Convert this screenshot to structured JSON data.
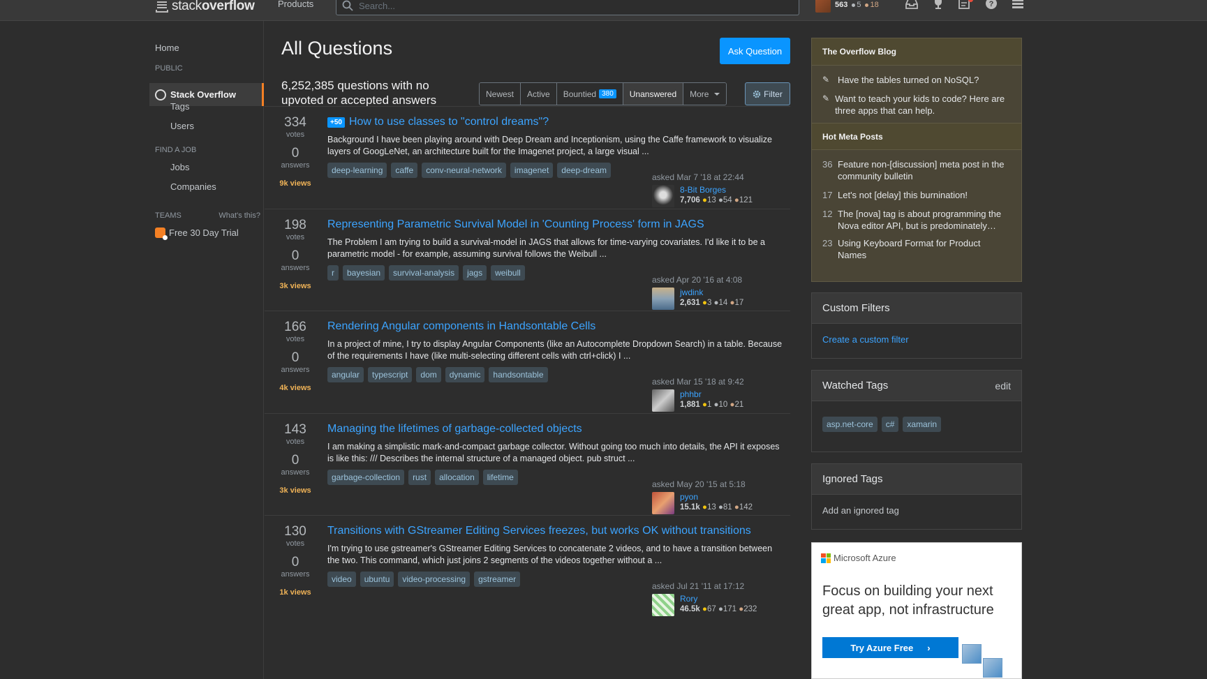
{
  "topbar": {
    "logo_light": "stack",
    "logo_bold": "overflow",
    "products": "Products",
    "search_placeholder": "Search...",
    "reputation": "563",
    "silver_badges": "5",
    "bronze_badges": "18"
  },
  "nav": {
    "home": "Home",
    "public_label": "PUBLIC",
    "stack_overflow": "Stack Overflow",
    "tags": "Tags",
    "users": "Users",
    "find_job_label": "FIND A JOB",
    "jobs": "Jobs",
    "companies": "Companies",
    "teams_label": "TEAMS",
    "whats_this": "What's this?",
    "free_trial": "Free 30 Day Trial"
  },
  "main": {
    "title": "All Questions",
    "ask_button": "Ask Question",
    "count_text": "6,252,385 questions with no upvoted or accepted answers",
    "tabs": [
      {
        "label": "Newest",
        "active": false
      },
      {
        "label": "Active",
        "active": false
      },
      {
        "label": "Bountied",
        "count": "380",
        "active": false
      },
      {
        "label": "Unanswered",
        "active": true
      },
      {
        "label": "More",
        "active": false
      }
    ],
    "filter_button": "Filter"
  },
  "questions": [
    {
      "votes": "334",
      "votes_label": "votes",
      "answers": "0",
      "answers_label": "answers",
      "views": "9k views",
      "bounty": "+50",
      "title": "How to use classes to \"control dreams\"?",
      "excerpt": "Background I have been playing around with Deep Dream and Inceptionism, using the Caffe framework to visualize layers of GoogLeNet, an architecture built for the Imagenet project, a large visual ...",
      "tags": [
        "deep-learning",
        "caffe",
        "conv-neural-network",
        "imagenet",
        "deep-dream"
      ],
      "asked": "asked Mar 7 '18 at 22:44",
      "user": "8-Bit Borges",
      "rep": "7,706",
      "gold": "13",
      "silver": "54",
      "bronze": "121"
    },
    {
      "votes": "198",
      "votes_label": "votes",
      "answers": "0",
      "answers_label": "answers",
      "views": "3k views",
      "bounty": "",
      "title": "Representing Parametric Survival Model in 'Counting Process' form in JAGS",
      "excerpt": "The Problem I am trying to build a survival-model in JAGS that allows for time-varying covariates. I'd like it to be a parametric model - for example, assuming survival follows the Weibull ...",
      "tags": [
        "r",
        "bayesian",
        "survival-analysis",
        "jags",
        "weibull"
      ],
      "asked": "asked Apr 20 '16 at 4:08",
      "user": "jwdink",
      "rep": "2,631",
      "gold": "3",
      "silver": "14",
      "bronze": "17"
    },
    {
      "votes": "166",
      "votes_label": "votes",
      "answers": "0",
      "answers_label": "answers",
      "views": "4k views",
      "bounty": "",
      "title": "Rendering Angular components in Handsontable Cells",
      "excerpt": "In a project of mine, I try to display Angular Components (like an Autocomplete Dropdown Search) in a table. Because of the requirements I have (like multi-selecting different cells with ctrl+click) I ...",
      "tags": [
        "angular",
        "typescript",
        "dom",
        "dynamic",
        "handsontable"
      ],
      "asked": "asked Mar 15 '18 at 9:42",
      "user": "phhbr",
      "rep": "1,881",
      "gold": "1",
      "silver": "10",
      "bronze": "21"
    },
    {
      "votes": "143",
      "votes_label": "votes",
      "answers": "0",
      "answers_label": "answers",
      "views": "3k views",
      "bounty": "",
      "title": "Managing the lifetimes of garbage-collected objects",
      "excerpt": "I am making a simplistic mark-and-compact garbage collector. Without going too much into details, the API it exposes is like this: /// Describes the internal structure of a managed object. pub struct ...",
      "tags": [
        "garbage-collection",
        "rust",
        "allocation",
        "lifetime"
      ],
      "asked": "asked May 20 '15 at 5:18",
      "user": "pyon",
      "rep": "15.1k",
      "gold": "13",
      "silver": "81",
      "bronze": "142"
    },
    {
      "votes": "130",
      "votes_label": "votes",
      "answers": "0",
      "answers_label": "answers",
      "views": "1k views",
      "bounty": "",
      "title": "Transitions with GStreamer Editing Services freezes, but works OK without transitions",
      "excerpt": "I'm trying to use gstreamer's GStreamer Editing Services to concatenate 2 videos, and to have a transition between the two. This command, which just joins 2 segments of the videos together without a ...",
      "tags": [
        "video",
        "ubuntu",
        "video-processing",
        "gstreamer"
      ],
      "asked": "asked Jul 21 '11 at 17:12",
      "user": "Rory",
      "rep": "46.5k",
      "gold": "67",
      "silver": "171",
      "bronze": "232"
    }
  ],
  "sidebar": {
    "blog_title": "The Overflow Blog",
    "blog_items": [
      "Have the tables turned on NoSQL?",
      "Want to teach your kids to code? Here are three apps that can help."
    ],
    "meta_title": "Hot Meta Posts",
    "meta_items": [
      {
        "num": "36",
        "text": "Feature non-[discussion] meta post in the community bulletin"
      },
      {
        "num": "17",
        "text": "Let's not [delay] this burnination!"
      },
      {
        "num": "12",
        "text": "The [nova] tag is about programming the Nova editor API, but is predominately…"
      },
      {
        "num": "23",
        "text": "Using Keyboard Format for Product Names"
      }
    ],
    "custom_filters_title": "Custom Filters",
    "create_filter": "Create a custom filter",
    "watched_title": "Watched Tags",
    "watched_edit": "edit",
    "watched_tags": [
      "asp.net-core",
      "c#",
      "xamarin"
    ],
    "ignored_title": "Ignored Tags",
    "add_ignored": "Add an ignored tag"
  },
  "ad": {
    "brand": "Microsoft Azure",
    "headline": "Focus on building your next great app, not infrastructure",
    "button": "Try Azure Free"
  }
}
